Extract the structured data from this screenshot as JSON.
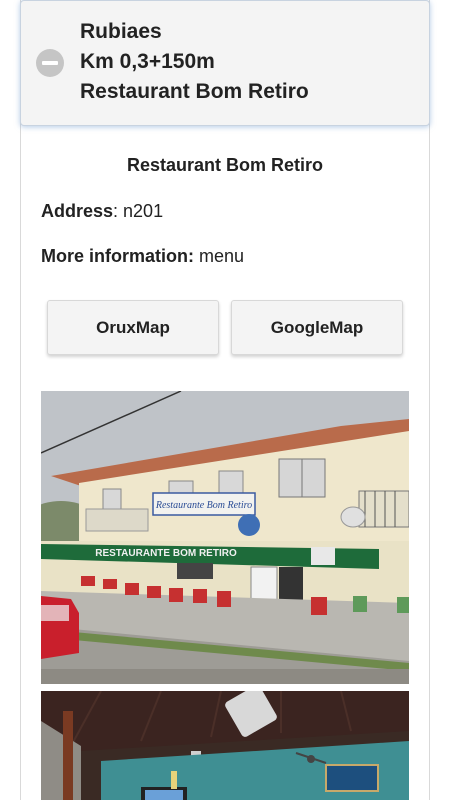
{
  "header": {
    "lines": [
      "Rubiaes",
      "Km 0,3+150m",
      "Restaurant Bom Retiro"
    ]
  },
  "place": {
    "title": "Restaurant Bom Retiro",
    "address_label": "Address",
    "address_value": ": n201",
    "info_label": "More information:",
    "info_value": " menu"
  },
  "buttons": {
    "oruxmap": "OruxMap",
    "googlemap": "GoogleMap"
  },
  "photos": {
    "sign_text": "Restaurante Bom Retiro",
    "awning_text": "RESTAURANTE BOM RETIRO"
  }
}
